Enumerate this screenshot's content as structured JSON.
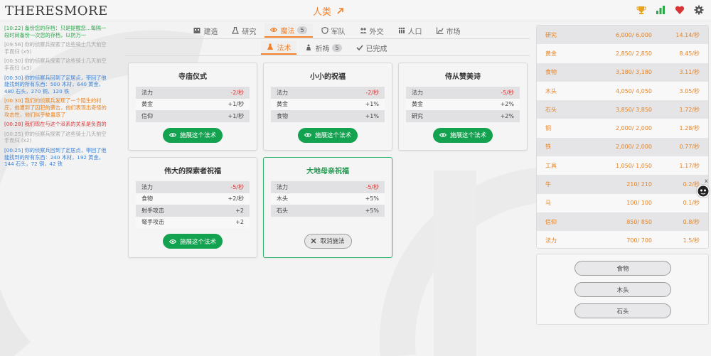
{
  "app": {
    "logo": "THERESMORE",
    "civ_label": "人类"
  },
  "log": [
    {
      "text": "[10:22] 备份您的存档：只是提醒您...每隔一段时间备份一次您的存档，以防万一",
      "color": "green"
    },
    {
      "text": "[09:56] 你的侦察兵探索了这些骑士几天前空手而归 (x5)",
      "color": "gray"
    },
    {
      "text": "[00:30] 你的侦察兵探索了这些骑士几天前空手而归 (x3)",
      "color": "gray"
    },
    {
      "text": "[00:30] 你的侦察兵回到了定居点，带回了他能找到的所有东西：500 木材，640 黄金，480 石头，270 铜，120 铁",
      "color": "blue"
    },
    {
      "text": "[00:30] 我们的侦察兵发现了一个陌生的村庄，他遭到了囚犯的袭击，他们表现出奇怪的攻击性，他们似乎被蛊惑了",
      "color": "orange"
    },
    {
      "text": "[00:28] 我们现在与这个派系的关系是负面的",
      "color": "red"
    },
    {
      "text": "[00:25] 你的侦察兵探索了这些骑士几天前空手而归 (x2)",
      "color": "gray"
    },
    {
      "text": "[00:25] 你的侦察兵回到了定居点，带回了他能找到的所有东西：240 木材，192 黄金，144 石头，72 铜，42 铁",
      "color": "blue"
    }
  ],
  "tabs": {
    "main": [
      {
        "label": "建造",
        "icon": "building-icon",
        "active": false
      },
      {
        "label": "研究",
        "icon": "flask-icon",
        "active": false
      },
      {
        "label": "魔法",
        "icon": "eye-icon",
        "active": true,
        "badge": "5"
      },
      {
        "label": "军队",
        "icon": "shield-icon",
        "active": false
      },
      {
        "label": "外交",
        "icon": "people-icon",
        "active": false
      },
      {
        "label": "人口",
        "icon": "population-icon",
        "active": false
      },
      {
        "label": "市场",
        "icon": "chart-icon",
        "active": false
      }
    ],
    "sub": [
      {
        "label": "法术",
        "icon": "flask-icon",
        "active": true
      },
      {
        "label": "祈祷",
        "icon": "pray-icon",
        "active": false,
        "badge": "5"
      },
      {
        "label": "已完成",
        "icon": "check-icon",
        "active": false
      }
    ]
  },
  "spells": [
    {
      "title": "寺庙仪式",
      "stats": [
        [
          "法力",
          "-2/秒",
          true
        ],
        [
          "黄金",
          "+1/秒",
          false
        ],
        [
          "信仰",
          "+1/秒",
          false
        ]
      ],
      "button": "施展这个法术",
      "active": false
    },
    {
      "title": "小小的祝福",
      "stats": [
        [
          "法力",
          "-2/秒",
          true
        ],
        [
          "黄金",
          "+1%",
          false
        ],
        [
          "食物",
          "+1%",
          false
        ]
      ],
      "button": "施展这个法术",
      "active": false
    },
    {
      "title": "侍从赞美诗",
      "stats": [
        [
          "法力",
          "-5/秒",
          true
        ],
        [
          "黄金",
          "+2%",
          false
        ],
        [
          "研究",
          "+2%",
          false
        ]
      ],
      "button": "施展这个法术",
      "active": false
    },
    {
      "title": "伟大的探索者祝福",
      "stats": [
        [
          "法力",
          "-5/秒",
          true
        ],
        [
          "食物",
          "+2/秒",
          false
        ],
        [
          "射手攻击",
          "+2",
          false
        ],
        [
          "弩手攻击",
          "+2",
          false
        ]
      ],
      "button": "施展这个法术",
      "active": false
    },
    {
      "title": "大地母亲祝福",
      "stats": [
        [
          "法力",
          "-5/秒",
          true
        ],
        [
          "木头",
          "+5%",
          false
        ],
        [
          "石头",
          "+5%",
          false
        ]
      ],
      "button": "取消施法",
      "active": true
    }
  ],
  "resources": [
    {
      "name": "研究",
      "amount": "6,000/ 6,000",
      "rate": "14.14/秒"
    },
    {
      "name": "黄金",
      "amount": "2,850/ 2,850",
      "rate": "8.45/秒"
    },
    {
      "name": "食物",
      "amount": "3,180/ 3,180",
      "rate": "3.11/秒"
    },
    {
      "name": "木头",
      "amount": "4,050/ 4,050",
      "rate": "3.05/秒"
    },
    {
      "name": "石头",
      "amount": "3,850/ 3,850",
      "rate": "1.72/秒"
    },
    {
      "name": "铜",
      "amount": "2,000/ 2,000",
      "rate": "1.28/秒"
    },
    {
      "name": "铁",
      "amount": "2,000/ 2,000",
      "rate": "0.77/秒"
    },
    {
      "name": "工具",
      "amount": "1,050/ 1,050",
      "rate": "1.17/秒"
    },
    {
      "name": "牛",
      "amount": "210/ 210",
      "rate": "0.2/秒"
    },
    {
      "name": "马",
      "amount": "100/ 100",
      "rate": "0.1/秒"
    },
    {
      "name": "信仰",
      "amount": "850/ 850",
      "rate": "0.8/秒"
    },
    {
      "name": "法力",
      "amount": "700/ 700",
      "rate": "1.5/秒"
    }
  ],
  "gather_buttons": [
    "食物",
    "木头",
    "石头"
  ],
  "side_close": "x",
  "colors": {
    "accent": "#f2802a",
    "cast_button": "#13a24f",
    "active_border": "#34b36a",
    "negative": "#d83535"
  }
}
